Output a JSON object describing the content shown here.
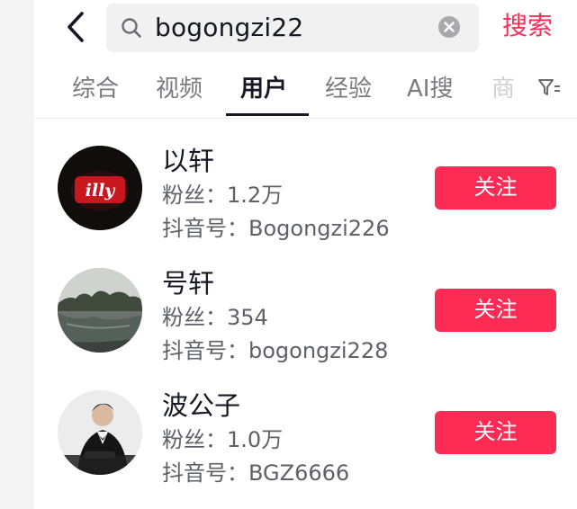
{
  "header": {
    "back_icon": "chevron-left-icon",
    "search_query": "bogongzi22",
    "search_button": "搜索",
    "accent_color": "#fe2c55"
  },
  "tabs": [
    {
      "label": "综合",
      "active": false
    },
    {
      "label": "视频",
      "active": false
    },
    {
      "label": "用户",
      "active": true
    },
    {
      "label": "经验",
      "active": false
    },
    {
      "label": "AI搜",
      "active": false
    },
    {
      "label": "商",
      "active": false
    }
  ],
  "users": [
    {
      "name": "以轩",
      "fans": "粉丝：1.2万",
      "douyin_id": "抖音号：Bogongzi226",
      "follow_label": "关注",
      "avatar_text": "illy"
    },
    {
      "name": "号轩",
      "fans": "粉丝：354",
      "douyin_id": "抖音号：bogongzi228",
      "follow_label": "关注"
    },
    {
      "name": "波公子",
      "fans": "粉丝：1.0万",
      "douyin_id": "抖音号：BGZ6666",
      "follow_label": "关注"
    }
  ]
}
